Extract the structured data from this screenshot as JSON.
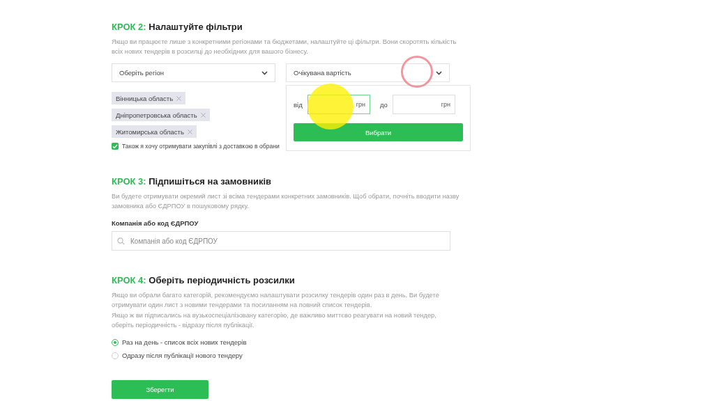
{
  "step2": {
    "step": "КРОК 2:",
    "title": "Налаштуйте фільтри",
    "description": "Якщо ви працюєте лише з конкретними регіонами та бюджетами, налаштуйте ці фільтри. Вони скоротять кількість всіх нових тендерів в розсилці до необхідних для вашого бізнесу.",
    "region_select": {
      "placeholder": "Оберіть регіон"
    },
    "value_select": {
      "placeholder": "Очікувана вартість",
      "expanded": true
    },
    "regions": [
      {
        "label": "Вінницька область"
      },
      {
        "label": "Дніпропетровська область"
      },
      {
        "label": "Житомирська область"
      }
    ],
    "delivery_checkbox": {
      "label": "Також я хочу отримувати закупівлі з доставкою в обрани",
      "checked": true
    },
    "value_panel": {
      "from_label": "від",
      "from_unit": "грн",
      "to_label": "до",
      "to_unit": "грн",
      "button": "Вибрати"
    }
  },
  "step3": {
    "step": "КРОК 3:",
    "title": "Підпишіться на замовників",
    "description": "Ви будете отримувати окремий лист зі всіма тендерами конкретних замовників. Щоб обрати, почніть вводити назву замовника або ЄДРПОУ в пошуковому рядку.",
    "field_label": "Компанія або код ЄДРПОУ",
    "search": {
      "placeholder": "Компанія або код ЄДРПОУ"
    }
  },
  "step4": {
    "step": "КРОК 4:",
    "title": "Оберіть періодичність розсилки",
    "paragraphs": [
      "Якщо ви обрали багато категорій, рекомендуємо налаштувати розсилку тендерів один раз в день. Ви будете отримувати один лист з новими тендерами та посиланням на повний список тендерів.",
      "Якщо ж ви підписались на вузькоспеціалізовану категорію, де важливо миттєво реагувати на новий тендер, оберіть періодичність - відразу після публікації."
    ],
    "options": [
      {
        "label": "Раз на день - список всіх нових тендерів",
        "selected": true
      },
      {
        "label": "Одразу після публікації нового тендеру",
        "selected": false
      }
    ]
  },
  "save_button": "Зберегти"
}
